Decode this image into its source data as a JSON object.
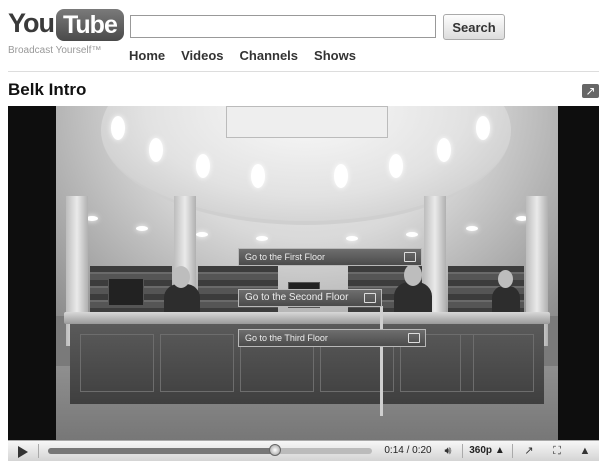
{
  "header": {
    "logo_you": "You",
    "logo_tube": "Tube",
    "tagline": "Broadcast Yourself™",
    "search": {
      "value": "",
      "placeholder": "",
      "button_label": "Search"
    },
    "nav": [
      "Home",
      "Videos",
      "Channels",
      "Shows"
    ]
  },
  "video": {
    "title": "Belk Intro",
    "annotations": [
      "Go to the First Floor",
      "Go to the Second Floor",
      "Go to the Third Floor"
    ]
  },
  "player": {
    "progress": 0.7,
    "time_display": "0:14 / 0:20",
    "quality_label": "360p",
    "icons": {
      "play": "play-icon",
      "volume": "volume-icon",
      "quality_arrow": "arrow-up-icon",
      "popout": "popout-icon",
      "fullscreen": "fullscreen-icon",
      "collapse": "collapse-icon"
    }
  }
}
